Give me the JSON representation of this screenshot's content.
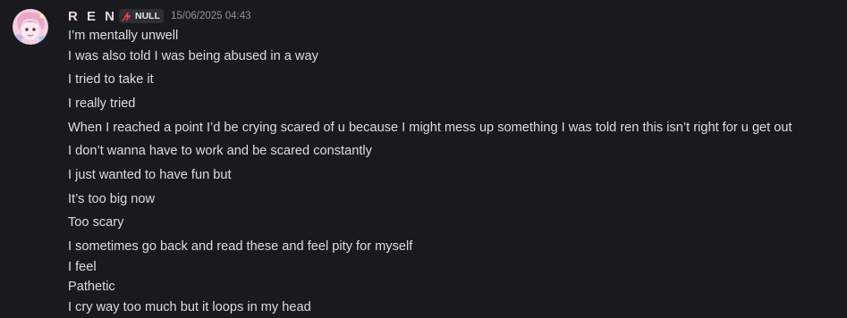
{
  "message": {
    "author": "R E N",
    "tag": "NULL",
    "tag_icon": "lightning-bolt-icon",
    "timestamp": "15/06/2025 04:43",
    "lines": [
      "I’m mentally unwell",
      "I was also told I was being abused in a way",
      "I tried to take it",
      "I really tried",
      "When I reached a point I’d be crying scared of u because I might mess up something I was told ren this isn’t right for u get out",
      "I don’t wanna have to work and be scared constantly",
      "I just wanted to have fun but",
      "It’s too big now",
      "Too scary",
      "I sometimes go back and read these and feel pity for myself",
      "I feel",
      "Pathetic",
      "I cry way too much but it loops in my head"
    ]
  },
  "colors": {
    "background": "#1a1a1e",
    "text": "#dbdee1",
    "username": "#e8d4e6",
    "timestamp": "#8e9297",
    "tag_bg": "#2e2f34",
    "tag_icon": "#f23f42"
  }
}
